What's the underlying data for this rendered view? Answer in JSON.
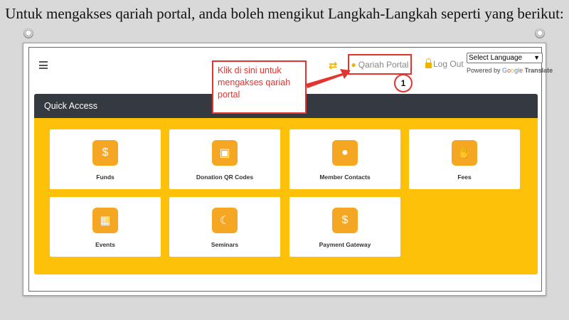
{
  "slide": {
    "title": "Untuk mengakses qariah portal, anda boleh mengikut Langkah-Langkah seperti yang berikut:"
  },
  "topbar": {
    "menu_icon": "hamburger-icon",
    "swap_icon": "swap-arrows-icon",
    "qariah_label": "Qariah Portal",
    "qariah_icon": "globe-icon",
    "logout_label": "Log Out",
    "logout_icon": "lock-icon",
    "language_select": "Select Language",
    "powered_by": "Powered by",
    "google": "Google",
    "translate": "Translate"
  },
  "annotation": {
    "callout_text": "Klik di sini untuk mengakses qariah portal",
    "step_number": "1",
    "color": "#e3342f"
  },
  "quick_access": {
    "title": "Quick Access",
    "panel_color": "#fdc10a",
    "header_color": "#343a40",
    "tiles": [
      {
        "label": "Funds",
        "icon": "money-icon"
      },
      {
        "label": "Donation QR Codes",
        "icon": "donation-box-icon"
      },
      {
        "label": "Member Contacts",
        "icon": "person-icon"
      },
      {
        "label": "Fees",
        "icon": "hand-money-icon"
      },
      {
        "label": "Events",
        "icon": "calendar-icon"
      },
      {
        "label": "Seminars",
        "icon": "crescent-calendar-icon"
      },
      {
        "label": "Payment Gateway",
        "icon": "payment-hand-icon"
      }
    ]
  }
}
